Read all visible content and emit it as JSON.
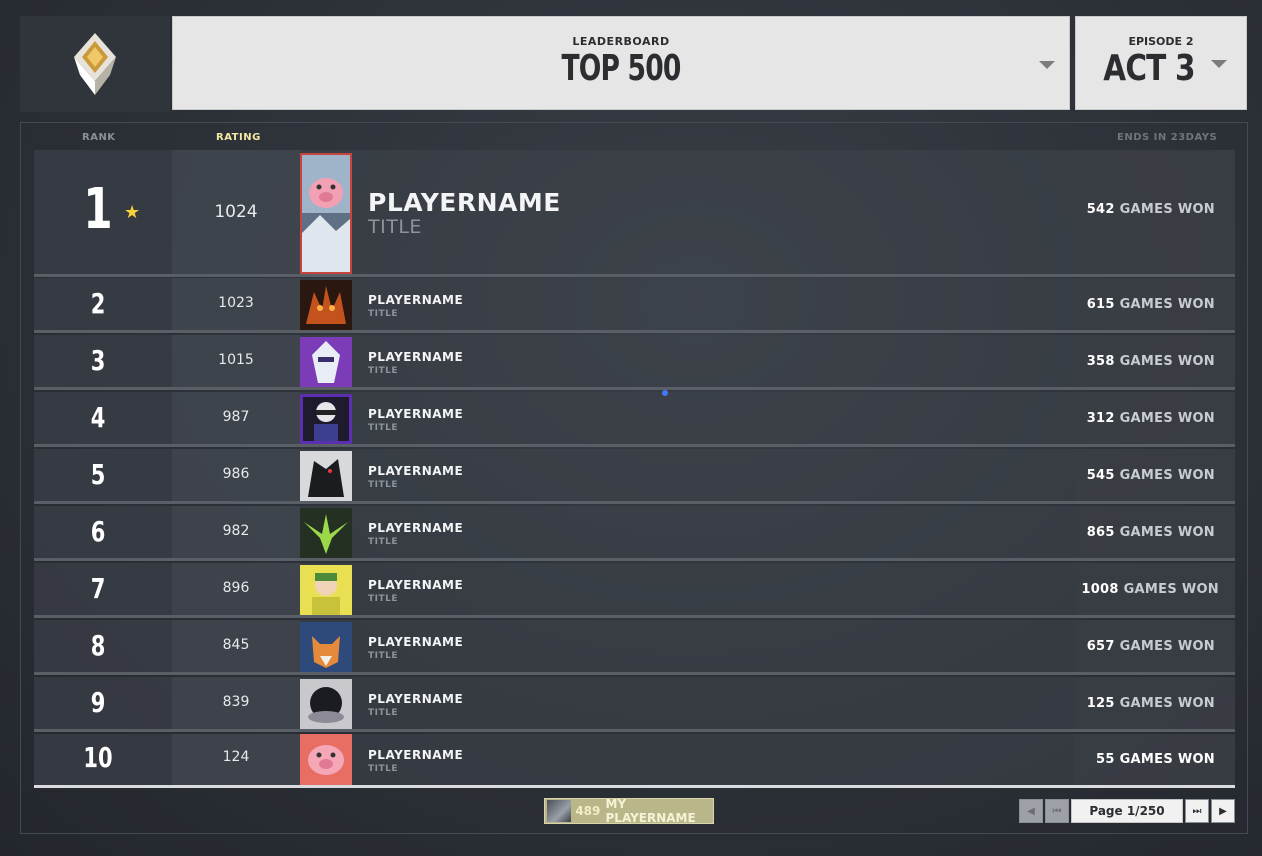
{
  "header": {
    "leaderboard_label": "LEADERBOARD",
    "leaderboard_value": "TOP 500",
    "episode_label": "EPISODE 2",
    "episode_value": "ACT 3"
  },
  "columns": {
    "rank": "RANK",
    "rating": "RATING",
    "ends": "ENDS IN 23DAYS"
  },
  "games_won_suffix": "GAMES WON",
  "rows": [
    {
      "rank": "1",
      "rating": "1024",
      "name": "PLAYERNAME",
      "title": "TITLE",
      "games": "542",
      "starred": true,
      "avatar": "pig-card-icon"
    },
    {
      "rank": "2",
      "rating": "1023",
      "name": "PLAYERNAME",
      "title": "TITLE",
      "games": "615",
      "avatar": "fire-dragon-card-icon"
    },
    {
      "rank": "3",
      "rating": "1015",
      "name": "PLAYERNAME",
      "title": "TITLE",
      "games": "358",
      "avatar": "white-robot-card-icon"
    },
    {
      "rank": "4",
      "rating": "987",
      "name": "PLAYERNAME",
      "title": "TITLE",
      "games": "312",
      "avatar": "agent-portrait-card-icon"
    },
    {
      "rank": "5",
      "rating": "986",
      "name": "PLAYERNAME",
      "title": "TITLE",
      "games": "545",
      "avatar": "black-wolf-card-icon"
    },
    {
      "rank": "6",
      "rating": "982",
      "name": "PLAYERNAME",
      "title": "TITLE",
      "games": "865",
      "avatar": "green-phoenix-card-icon"
    },
    {
      "rank": "7",
      "rating": "896",
      "name": "PLAYERNAME",
      "title": "TITLE",
      "games": "1008",
      "avatar": "yellow-agent-card-icon"
    },
    {
      "rank": "8",
      "rating": "845",
      "name": "PLAYERNAME",
      "title": "TITLE",
      "games": "657",
      "avatar": "fox-card-icon"
    },
    {
      "rank": "9",
      "rating": "839",
      "name": "PLAYERNAME",
      "title": "TITLE",
      "games": "125",
      "avatar": "dark-orb-card-icon"
    },
    {
      "rank": "10",
      "rating": "124",
      "name": "PLAYERNAME",
      "title": "TITLE",
      "games": "55",
      "avatar": "pink-pig-card-icon"
    }
  ],
  "my_player": {
    "rank": "489",
    "name": "MY PLAYERNAME"
  },
  "pagination": {
    "page_label": "Page 1/250"
  },
  "colors": {
    "rating_header": "#f3e9a4",
    "muted_header": "#8a9099",
    "star": "#f7d33a",
    "header_panel": "#e6e6e6",
    "my_player_bg": "#b9b78a"
  }
}
